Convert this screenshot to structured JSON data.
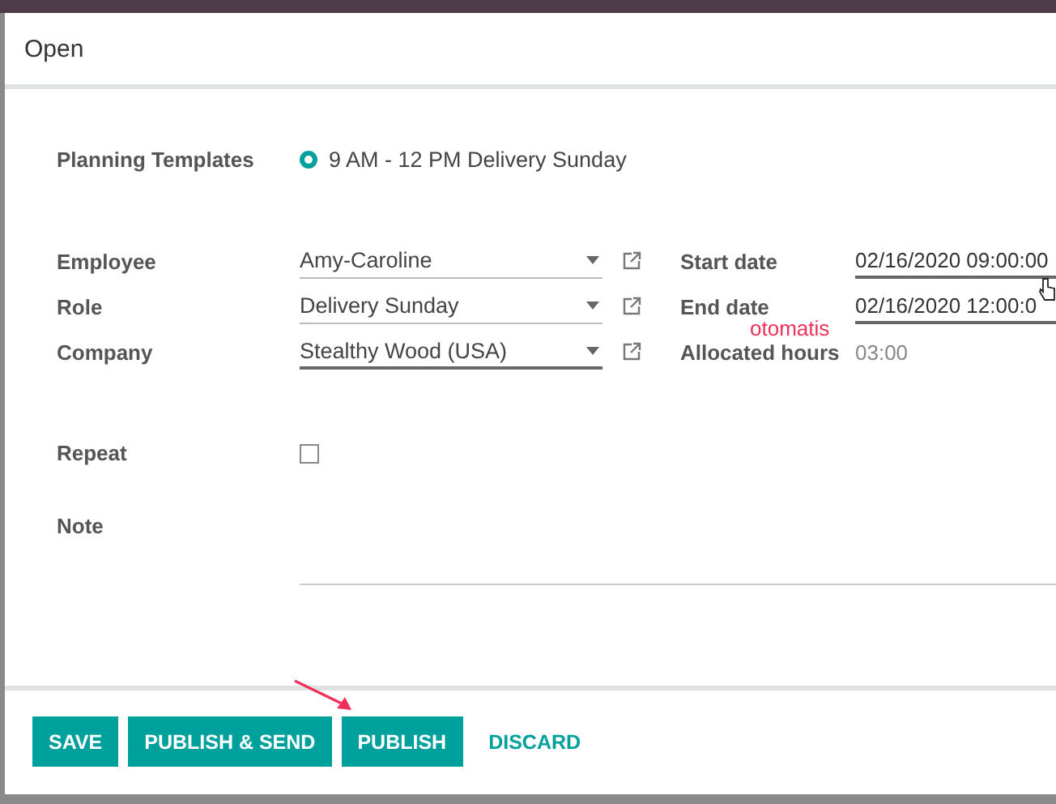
{
  "dialog": {
    "title": "Open"
  },
  "template": {
    "label": "Planning Templates",
    "option": "9 AM - 12 PM Delivery Sunday",
    "selected": true
  },
  "left_fields": [
    {
      "label": "Employee",
      "value": "Amy-Caroline",
      "focused": false
    },
    {
      "label": "Role",
      "value": "Delivery Sunday",
      "focused": false
    },
    {
      "label": "Company",
      "value": "Stealthy Wood (USA)",
      "focused": true
    }
  ],
  "right_fields": [
    {
      "label": "Start date",
      "value": "02/16/2020 09:00:00",
      "kind": "input"
    },
    {
      "label": "End date",
      "value": "02/16/2020 12:00:0",
      "kind": "input"
    },
    {
      "label": "Allocated hours",
      "value": "03:00",
      "kind": "readonly"
    }
  ],
  "repeat": {
    "label": "Repeat",
    "checked": false
  },
  "note": {
    "label": "Note"
  },
  "annotation": {
    "text": "otomatis"
  },
  "buttons": [
    {
      "label": "SAVE",
      "kind": "primary"
    },
    {
      "label": "PUBLISH & SEND",
      "kind": "primary"
    },
    {
      "label": "PUBLISH",
      "kind": "primary"
    },
    {
      "label": "DISCARD",
      "kind": "link"
    }
  ]
}
